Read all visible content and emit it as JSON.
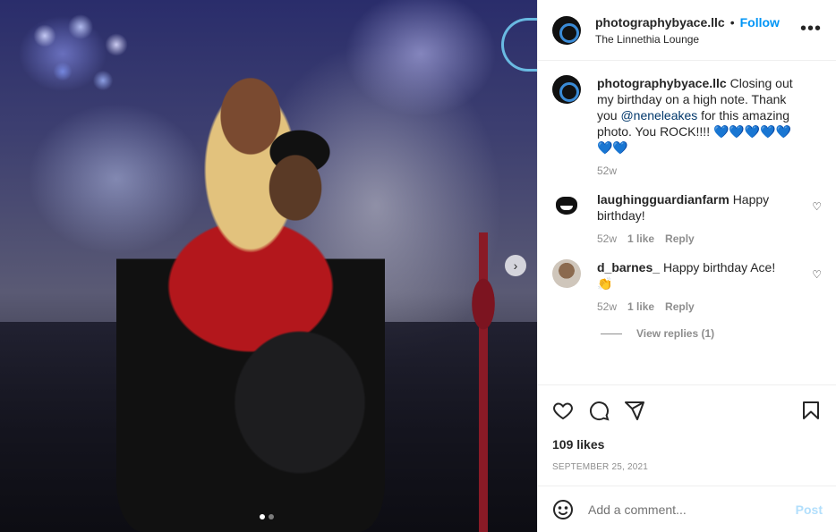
{
  "post": {
    "username": "photographybyace.llc",
    "follow_label": "Follow",
    "separator": "•",
    "location": "The Linnethia Lounge",
    "more_icon": "more-horizontal-icon",
    "carousel": {
      "current": 1,
      "total": 2
    }
  },
  "caption": {
    "username": "photographybyace.llc",
    "text_before": "Closing out my birthday on a high note. Thank you ",
    "mention": "@neneleakes",
    "text_after": " for this amazing photo. You ROCK!!!! ",
    "hearts": "💙💙💙💙💙💙💙",
    "time": "52w"
  },
  "comments": [
    {
      "username": "laughingguardianfarm",
      "text": "Happy birthday!",
      "time": "52w",
      "likes": "1 like",
      "reply": "Reply"
    },
    {
      "username": "d_barnes_",
      "text": "Happy birthday Ace!",
      "emoji": "👏",
      "time": "52w",
      "likes": "1 like",
      "reply": "Reply"
    }
  ],
  "view_replies": "View replies (1)",
  "engagement": {
    "likes": "109 likes",
    "date": "SEPTEMBER 25, 2021"
  },
  "composer": {
    "placeholder": "Add a comment...",
    "post_label": "Post"
  },
  "colors": {
    "accent": "#0095f6",
    "post_disabled": "#b2dffc",
    "muted": "#8e8e8e"
  }
}
